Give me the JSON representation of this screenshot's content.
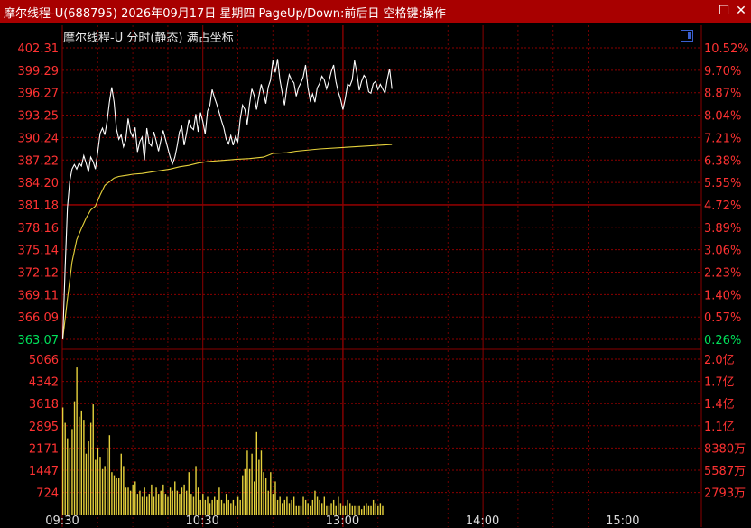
{
  "window": {
    "title": "摩尔线程-U(688795) 2026年09月17日 星期四 PageUp/Down:前后日 空格键:操作",
    "restore_glyph": "☐",
    "close_glyph": "✕"
  },
  "chart_header": {
    "title": "摩尔线程-U   分时(静态) 满占坐标"
  },
  "colors": {
    "title_bar": "#a80000",
    "grid": "#8a0000",
    "up": "#ff3232",
    "down": "#00e05a",
    "price_line": "#ffffff",
    "avg_line": "#e6d23c",
    "volume_bar": "#e6d23c"
  },
  "chart_data": [
    {
      "type": "line",
      "x_range": [
        "09:30",
        "15:00"
      ],
      "x_tick_labels": [
        "09:30",
        "10:30",
        "13:00",
        "14:00",
        "15:00"
      ],
      "y_left_ticks": [
        "402.31",
        "399.29",
        "396.27",
        "393.25",
        "390.24",
        "387.22",
        "384.20",
        "381.18",
        "378.16",
        "375.14",
        "372.12",
        "369.11",
        "366.09",
        "363.07"
      ],
      "y_right_ticks": [
        "10.52%",
        "9.70%",
        "8.87%",
        "8.04%",
        "7.21%",
        "6.38%",
        "5.55%",
        "4.72%",
        "3.89%",
        "3.06%",
        "2.23%",
        "1.40%",
        "0.57%",
        "0.26%"
      ],
      "y_range": [
        363.07,
        402.31
      ],
      "series": [
        {
          "x": [
            0,
            1,
            2,
            3,
            4,
            5,
            6,
            7,
            8,
            9,
            10,
            11,
            12,
            13,
            14,
            15,
            16,
            17,
            18,
            19,
            20,
            21,
            22,
            23,
            24,
            25,
            26,
            27,
            28,
            29,
            30,
            31,
            32,
            33,
            34,
            35,
            36,
            37,
            38,
            39,
            40,
            41,
            42,
            43,
            44,
            45,
            46,
            47,
            48,
            49,
            50,
            51,
            52,
            53,
            54,
            55,
            56,
            57,
            58,
            59,
            60,
            61,
            62,
            63,
            64,
            65,
            66,
            67,
            68,
            69,
            70,
            71,
            72,
            73,
            74,
            75,
            76,
            77,
            78,
            79,
            80,
            81,
            82,
            83,
            84,
            85,
            86,
            87,
            88,
            89,
            90,
            91,
            92,
            93,
            94,
            95,
            96,
            97,
            98,
            99,
            100,
            101,
            102,
            103,
            104,
            105,
            106,
            107,
            108,
            109,
            110,
            111,
            112,
            113,
            114,
            115,
            116,
            117,
            118,
            119,
            120,
            121,
            122,
            123,
            124,
            125,
            126,
            127,
            128,
            129,
            130,
            131,
            132,
            133,
            134,
            135,
            136,
            137,
            138,
            139,
            140,
            141
          ],
          "values": [
            363.1,
            372.5,
            380.8,
            384.4,
            386.0,
            386.6,
            386.0,
            386.8,
            386.4,
            387.8,
            386.8,
            385.6,
            387.6,
            387.0,
            386.0,
            388.3,
            390.8,
            391.5,
            390.6,
            392.4,
            395.0,
            397.0,
            395.0,
            391.4,
            390.0,
            390.6,
            389.0,
            389.9,
            392.8,
            391.0,
            390.3,
            391.6,
            388.3,
            389.7,
            390.3,
            387.2,
            391.5,
            389.5,
            389.1,
            391.0,
            389.8,
            388.4,
            389.8,
            391.2,
            390.0,
            388.8,
            387.6,
            386.7,
            387.6,
            389.1,
            391.0,
            391.7,
            389.2,
            390.8,
            392.6,
            391.6,
            391.3,
            393.4,
            391.0,
            393.6,
            392.4,
            390.7,
            393.8,
            394.6,
            396.7,
            395.6,
            394.7,
            393.6,
            392.5,
            391.5,
            390.0,
            389.4,
            390.5,
            389.2,
            390.4,
            389.7,
            392.7,
            394.6,
            394.0,
            392.0,
            394.7,
            396.8,
            395.9,
            394.0,
            395.8,
            397.4,
            396.2,
            394.8,
            397.0,
            398.0,
            400.6,
            399.0,
            400.8,
            398.0,
            396.3,
            394.6,
            397.0,
            398.7,
            398.0,
            397.6,
            395.8,
            397.0,
            397.6,
            398.4,
            400.0,
            397.0,
            395.2,
            396.1,
            395.0,
            396.9,
            397.5,
            398.5,
            398.0,
            396.8,
            397.8,
            399.1,
            400.0,
            397.8,
            396.4,
            395.4,
            394.0,
            395.5,
            397.4,
            397.2,
            398.0,
            400.6,
            398.9,
            396.6,
            397.8,
            398.6,
            398.2,
            396.4,
            396.2,
            397.5,
            397.8,
            396.7,
            397.4,
            396.8,
            396.2,
            398.0,
            399.5,
            396.8
          ]
        },
        {
          "x": [
            0,
            2,
            4,
            6,
            8,
            10,
            12,
            14,
            16,
            18,
            20,
            22,
            24,
            26,
            28,
            30,
            34,
            38,
            42,
            46,
            50,
            54,
            58,
            62,
            66,
            70,
            74,
            80,
            86,
            90,
            96,
            100,
            110,
            120,
            130,
            141
          ],
          "values": [
            363.1,
            368.5,
            373.5,
            376.5,
            378.0,
            379.4,
            380.5,
            381.0,
            382.5,
            383.8,
            384.3,
            384.8,
            385.0,
            385.1,
            385.2,
            385.3,
            385.4,
            385.6,
            385.8,
            386.0,
            386.3,
            386.5,
            386.8,
            387.0,
            387.1,
            387.2,
            387.3,
            387.4,
            387.6,
            388.1,
            388.2,
            388.4,
            388.7,
            388.9,
            389.1,
            389.3
          ]
        }
      ]
    },
    {
      "type": "bar",
      "x_range": [
        "09:30",
        "15:00"
      ],
      "y_left_ticks": [
        "5066",
        "4342",
        "3618",
        "2895",
        "2171",
        "1447",
        "724"
      ],
      "y_right_ticks": [
        "2.0亿",
        "1.7亿",
        "1.4亿",
        "1.1亿",
        "8380万",
        "5587万",
        "2793万"
      ],
      "y_range": [
        0,
        5066
      ],
      "values": [
        3500,
        3000,
        2500,
        2200,
        2800,
        3700,
        4800,
        3200,
        3400,
        3100,
        2000,
        2400,
        3000,
        3600,
        1800,
        2200,
        1900,
        1500,
        1600,
        2200,
        2600,
        1400,
        1300,
        1200,
        1200,
        2000,
        1600,
        900,
        900,
        800,
        1000,
        1100,
        700,
        800,
        600,
        900,
        600,
        700,
        1000,
        600,
        900,
        700,
        800,
        1000,
        700,
        600,
        900,
        800,
        1100,
        800,
        700,
        900,
        1000,
        800,
        1400,
        700,
        600,
        1600,
        900,
        500,
        700,
        500,
        600,
        400,
        500,
        600,
        500,
        900,
        500,
        400,
        700,
        500,
        400,
        500,
        300,
        600,
        500,
        1300,
        1500,
        2100,
        1500,
        2000,
        1100,
        2700,
        1800,
        2100,
        1400,
        1200,
        800,
        1400,
        700,
        1100,
        500,
        600,
        400,
        500,
        600,
        400,
        500,
        600,
        300,
        300,
        300,
        600,
        500,
        400,
        300,
        500,
        800,
        600,
        500,
        400,
        600,
        300,
        300,
        400,
        500,
        300,
        600,
        400,
        300,
        300,
        500,
        400,
        300,
        300,
        300,
        300,
        200,
        300,
        400,
        300,
        300,
        500,
        400,
        300,
        400,
        300
      ]
    }
  ]
}
